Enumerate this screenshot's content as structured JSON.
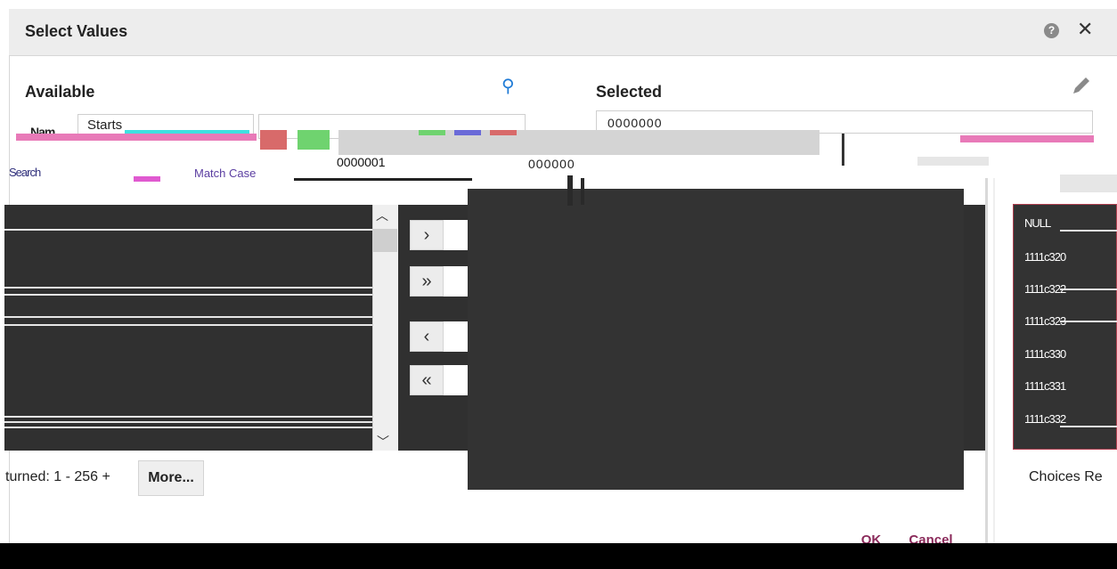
{
  "dialog": {
    "title": "Select Values",
    "help_icon": "help-circle-icon",
    "close_icon": "close-icon"
  },
  "available": {
    "label": "Available",
    "filter_value": "Starts",
    "search_label": "Search",
    "match_case_label": "Match Case",
    "returned_text": "turned: 1 - 256 +",
    "more_label": "More...",
    "search_icon": "search-icon"
  },
  "selected": {
    "label": "Selected",
    "input_value": "0000000",
    "edit_icon": "pencil-icon",
    "choices_text": "Choices Re"
  },
  "values_visible": {
    "item_a": "0000001",
    "item_b": "000000"
  },
  "move_buttons": {
    "move": "›",
    "move_all": "»",
    "remove": "‹",
    "remove_all": "«"
  },
  "right_list": {
    "items": [
      "NULL",
      "1111c320",
      "1111c322",
      "1111c323",
      "1111c330",
      "1111c331",
      "1111c332"
    ]
  },
  "footer": {
    "ok_label": "OK",
    "cancel_label": "Cancel"
  },
  "colors": {
    "dark_panel": "#303030",
    "header_bg": "#ededed",
    "accent_link": "#5b3ea1",
    "button_text": "#8a2a5a"
  }
}
